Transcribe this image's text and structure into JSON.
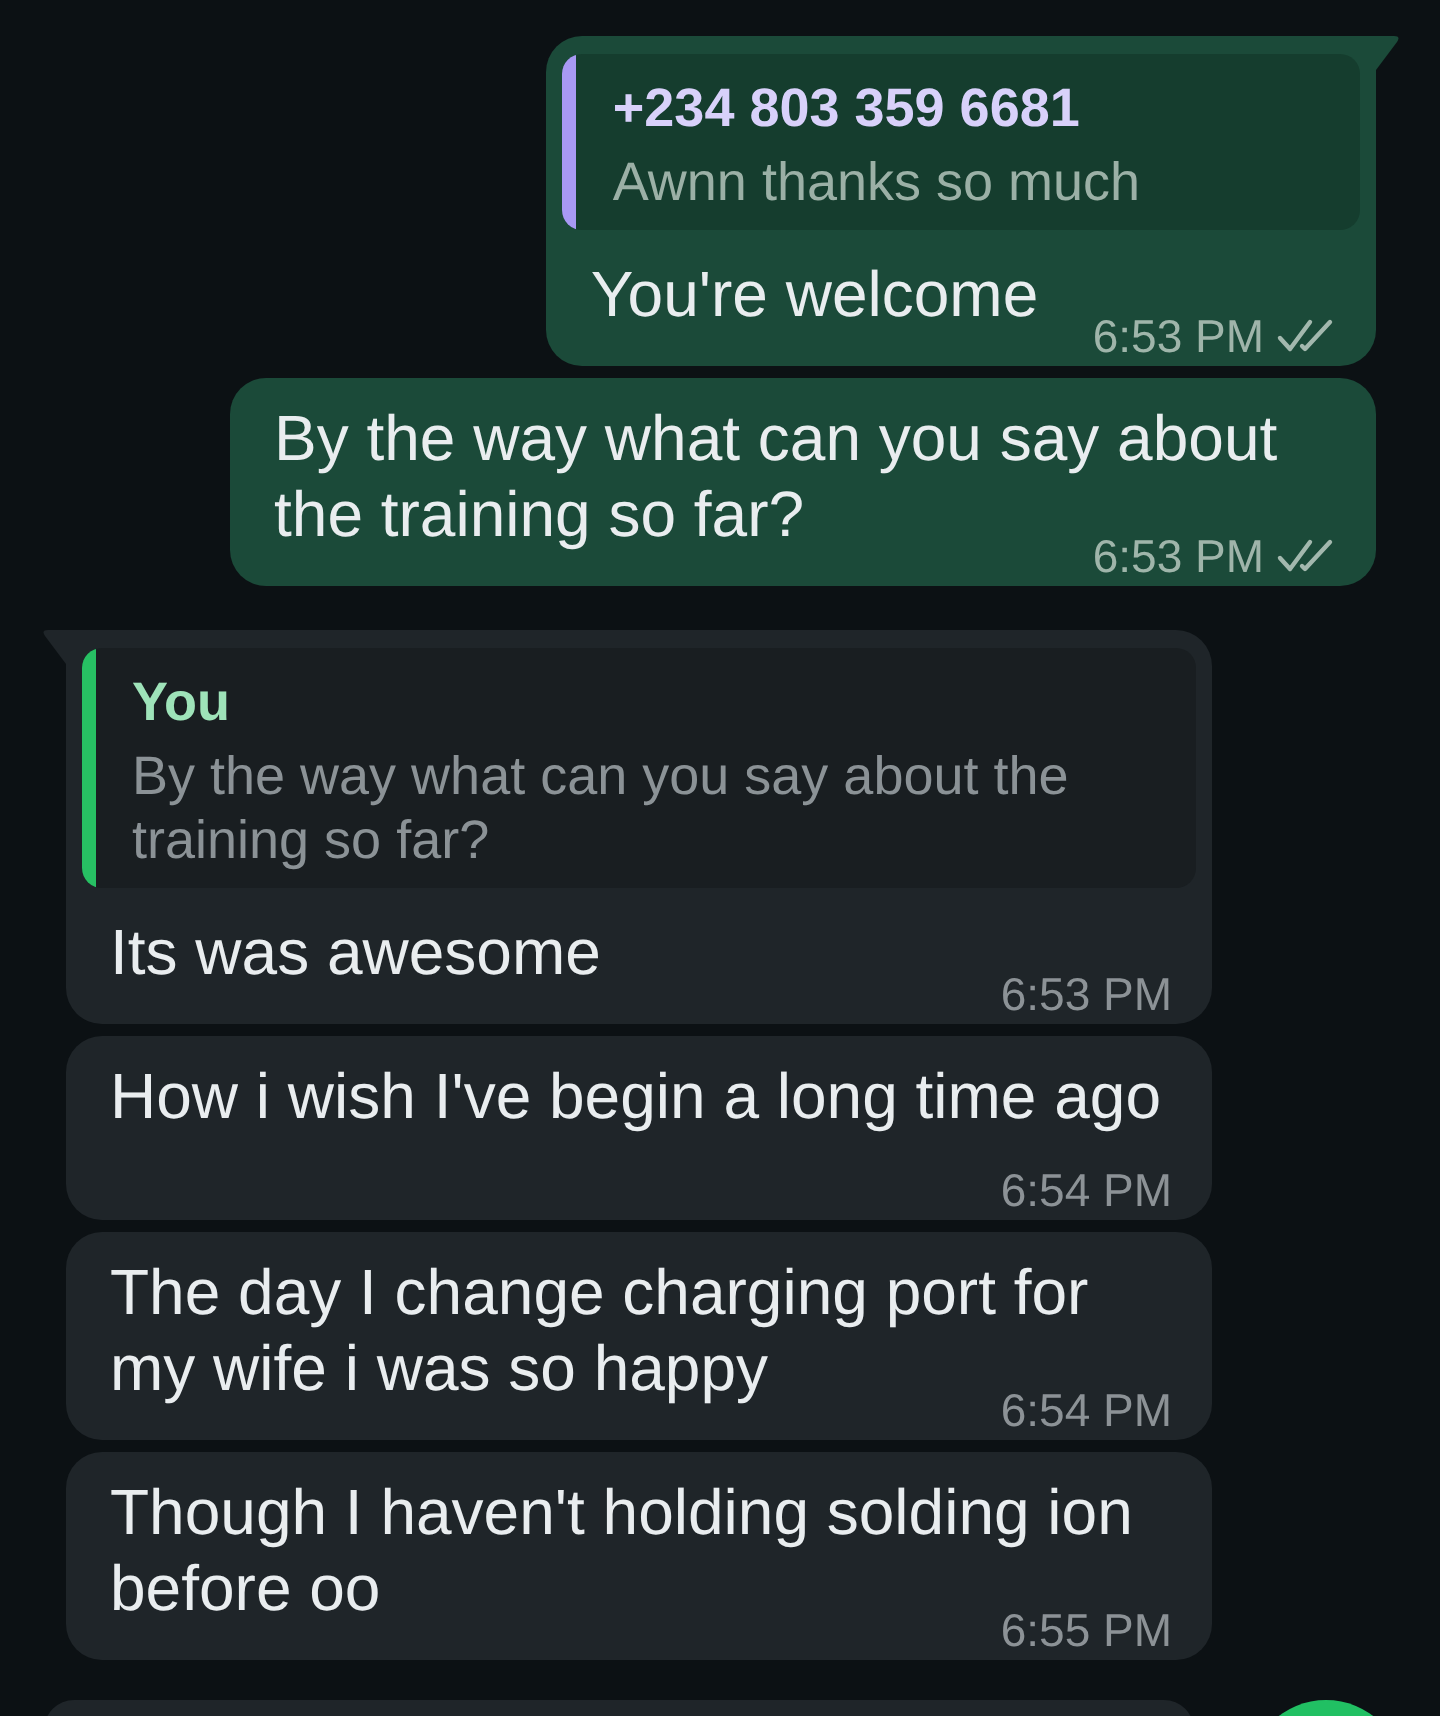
{
  "messages": [
    {
      "outgoing": true,
      "tail": true,
      "quote": {
        "author": "+234 803 359 6681",
        "text": "Awnn thanks so much",
        "color": "#a899f4"
      },
      "text": "You're welcome",
      "time": "6:53 PM",
      "delivered": true,
      "read": false
    },
    {
      "outgoing": true,
      "tail": false,
      "text": "By the way what can you say about the training so far?",
      "time": "6:53 PM",
      "delivered": true,
      "read": false
    },
    {
      "outgoing": false,
      "tail": true,
      "quote": {
        "author": "You",
        "text": "By the way what can you say about the training so far?",
        "color": "#27c063"
      },
      "text": "Its was awesome",
      "time": "6:53 PM"
    },
    {
      "outgoing": false,
      "tail": false,
      "text": "How i wish I've begin a long time ago",
      "time": "6:54 PM"
    },
    {
      "outgoing": false,
      "tail": false,
      "text": "The day I change charging port for my wife i was so happy",
      "time": "6:54 PM"
    },
    {
      "outgoing": false,
      "tail": false,
      "text": "Though I haven't holding solding ion before oo",
      "time": "6:55 PM"
    }
  ]
}
